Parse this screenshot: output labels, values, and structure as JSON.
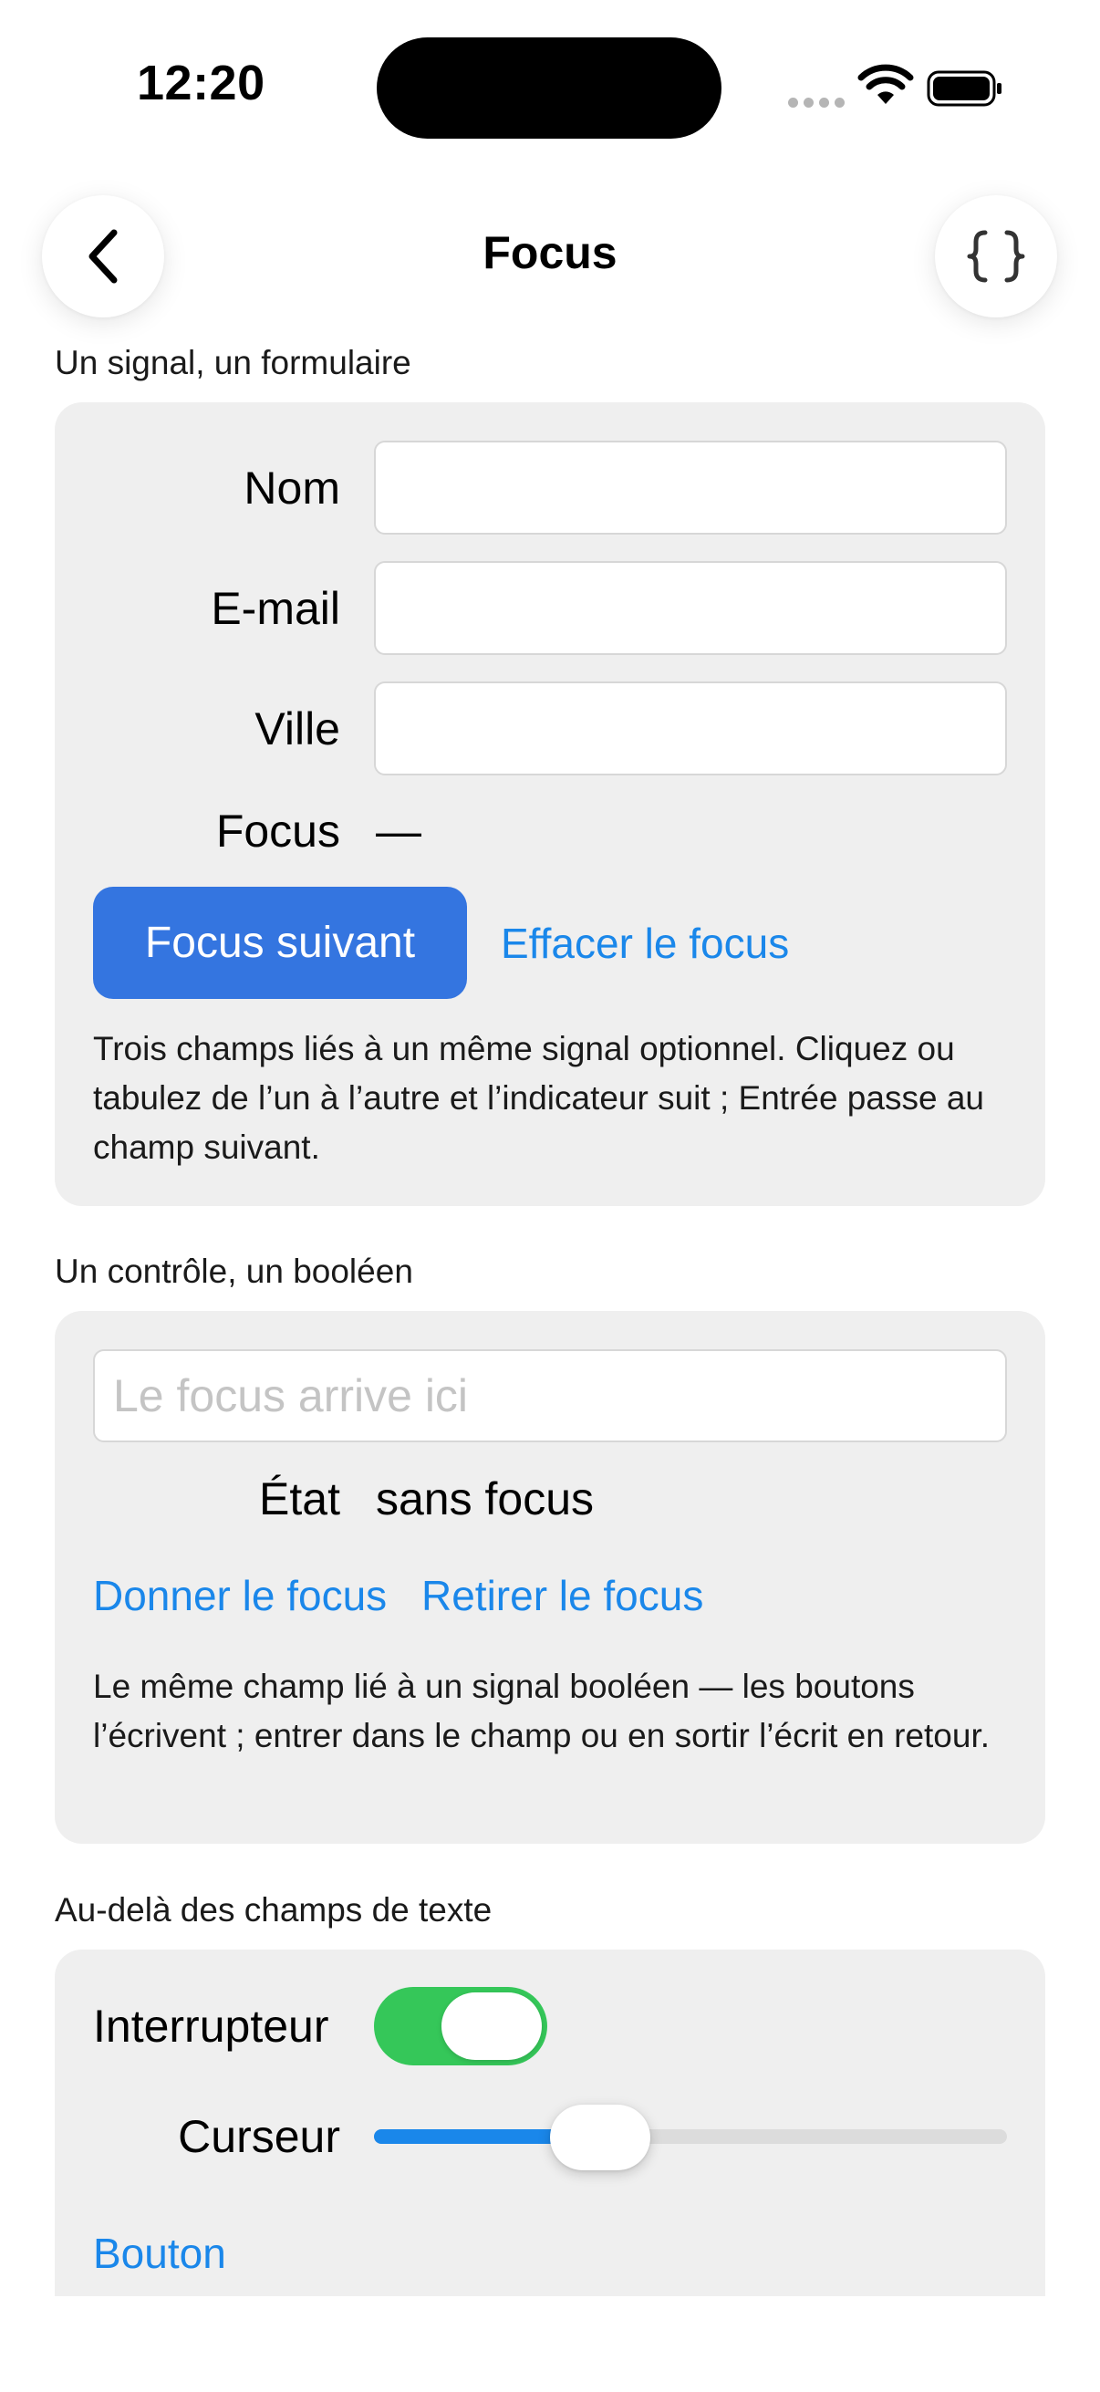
{
  "status_bar": {
    "time": "12:20"
  },
  "nav": {
    "title": "Focus",
    "back_icon": "chevron-left-icon",
    "code_icon": "curly-braces-icon"
  },
  "section1": {
    "header": "Un signal, un formulaire",
    "fields": [
      {
        "label": "Nom",
        "value": ""
      },
      {
        "label": "E-mail",
        "value": ""
      },
      {
        "label": "Ville",
        "value": ""
      }
    ],
    "focus_label": "Focus",
    "focus_value": "—",
    "next_button": "Focus suivant",
    "clear_link": "Effacer le focus",
    "description": "Trois champs liés à un même signal optionnel. Cliquez ou tabulez de l’un à l’autre et l’indicateur suit ; Entrée passe au champ suivant."
  },
  "section2": {
    "header": "Un contrôle, un booléen",
    "field_placeholder": "Le focus arrive ici",
    "field_value": "",
    "state_label": "État",
    "state_value": "sans focus",
    "give_link": "Donner le focus",
    "remove_link": "Retirer le focus",
    "description": "Le même champ lié à un signal booléen — les boutons l’écrivent ; entrer dans le champ ou en sortir l’écrit en retour."
  },
  "section3": {
    "header": "Au-delà des champs de texte",
    "toggle_label": "Interrupteur",
    "toggle_on": true,
    "slider_label": "Curseur",
    "slider_value": 0.33,
    "button_link": "Bouton"
  },
  "colors": {
    "accent": "#1a87ea",
    "primary_button": "#3475e0",
    "toggle_on": "#35c759",
    "card_bg": "#efefef"
  }
}
